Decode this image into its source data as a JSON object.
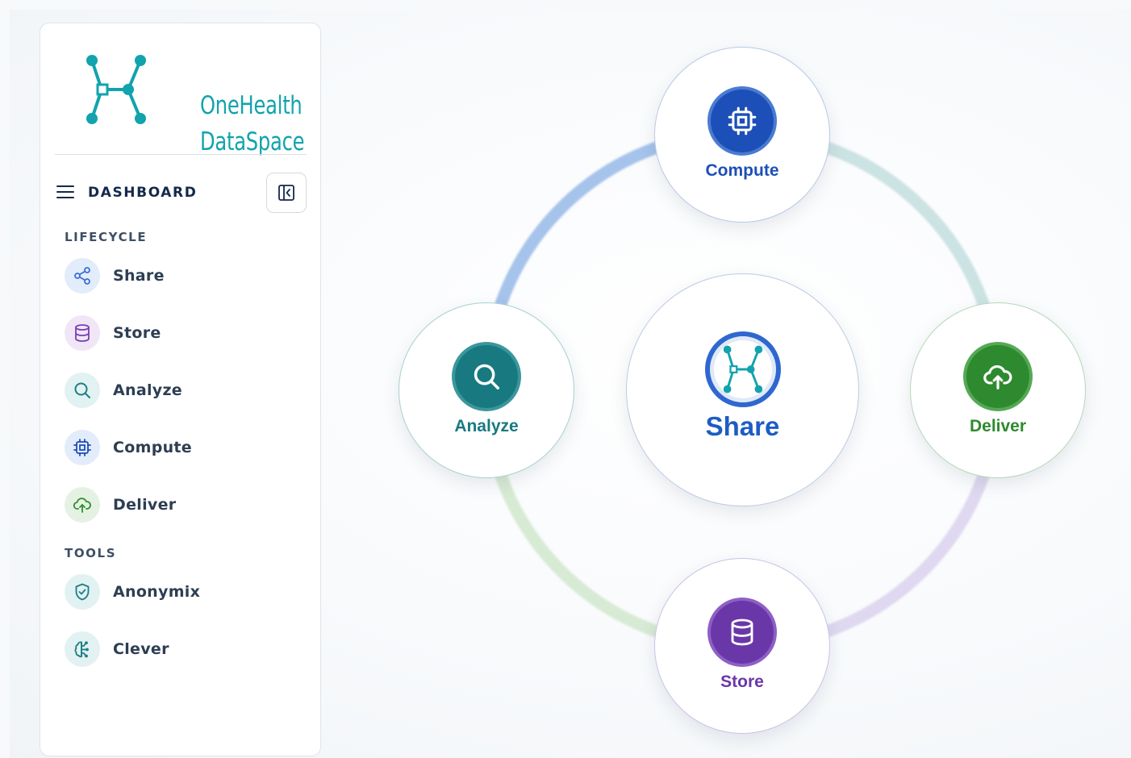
{
  "brand": {
    "line1": "OneHealth",
    "line2": "DataSpace",
    "color": "#12a3ad"
  },
  "sidebar": {
    "title": "DASHBOARD",
    "collapse_icon": "sidebar-collapse-icon",
    "sections": {
      "lifecycle": "LIFECYCLE",
      "tools": "TOOLS"
    },
    "lifecycle_items": [
      {
        "label": "Share",
        "icon": "share-icon",
        "color": "#3b6fd6"
      },
      {
        "label": "Store",
        "icon": "database-icon",
        "color": "#7a3fb8"
      },
      {
        "label": "Analyze",
        "icon": "search-icon",
        "color": "#1a7f86"
      },
      {
        "label": "Compute",
        "icon": "cpu-icon",
        "color": "#1d4fb8"
      },
      {
        "label": "Deliver",
        "icon": "cloud-upload-icon",
        "color": "#2e8f2e"
      }
    ],
    "tool_items": [
      {
        "label": "Anonymix",
        "icon": "shield-check-icon",
        "color": "#1a7f86"
      },
      {
        "label": "Clever",
        "icon": "brain-icon",
        "color": "#1a7f86"
      }
    ]
  },
  "diagram": {
    "center": {
      "label": "Share",
      "icon": "onehealth-logo-icon",
      "color": "#1d5cc4"
    },
    "nodes": [
      {
        "label": "Compute",
        "icon": "cpu-icon",
        "color": "#1d4fb8"
      },
      {
        "label": "Deliver",
        "icon": "cloud-upload-icon",
        "color": "#2e8a2e"
      },
      {
        "label": "Store",
        "icon": "database-icon",
        "color": "#6a37a8"
      },
      {
        "label": "Analyze",
        "icon": "search-icon",
        "color": "#187a80"
      }
    ]
  }
}
